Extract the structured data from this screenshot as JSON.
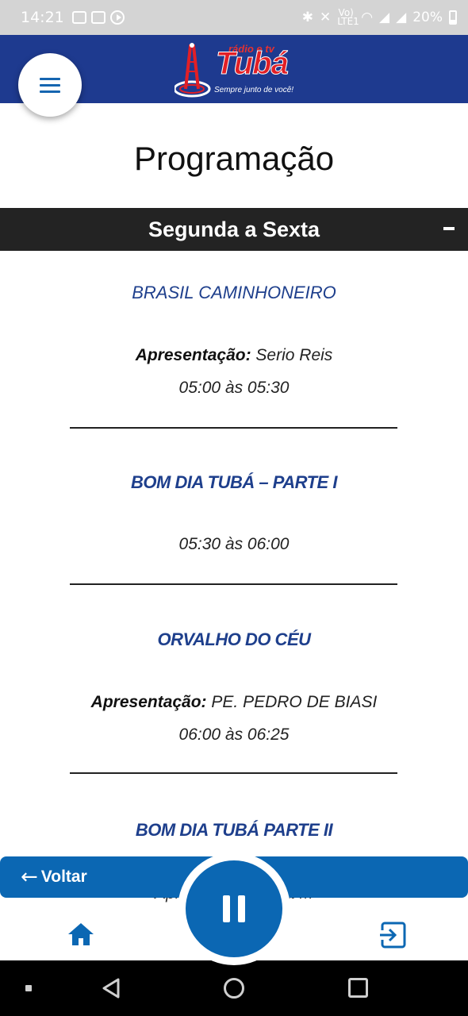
{
  "status_bar": {
    "time": "14:21",
    "network_label": "Vo) LTE1",
    "battery": "20%"
  },
  "header": {
    "logo_top": "rádio e tv",
    "logo_brand": "Tubá",
    "logo_slogan": "Sempre junto de você!",
    "menu_icon": "hamburger-icon"
  },
  "page": {
    "title": "Programação"
  },
  "section": {
    "label": "Segunda a Sexta",
    "toggle_icon": "minus-icon"
  },
  "programs": [
    {
      "name": "BRASIL CAMINHONEIRO",
      "presenter_label": "Apresentação:",
      "presenter": "Serio Reis",
      "time": "05:00 às 05:30"
    },
    {
      "name": "BOM DIA TUBÁ – PARTE I",
      "time": "05:30 às 06:00"
    },
    {
      "name": "ORVALHO DO CÉU",
      "presenter_label": "Apresentação:",
      "presenter": "PE. PEDRO DE BIASI",
      "time": "06:00 às 06:25"
    },
    {
      "name": "BOM DIA TUBÁ PARTE II",
      "partial_line": "Apresenta                                  adadina M"
    }
  ],
  "separator": "___________________________________",
  "player": {
    "back_label": "Voltar",
    "back_icon": "arrow-left-icon",
    "play_state_icon": "pause-icon"
  },
  "bottom_nav": {
    "home_icon": "home-icon",
    "exit_icon": "exit-icon"
  },
  "colors": {
    "header_bg": "#1e3a8f",
    "accent_blue": "#0b67b3",
    "program_name": "#1e3f8c",
    "section_bg": "#232323"
  }
}
